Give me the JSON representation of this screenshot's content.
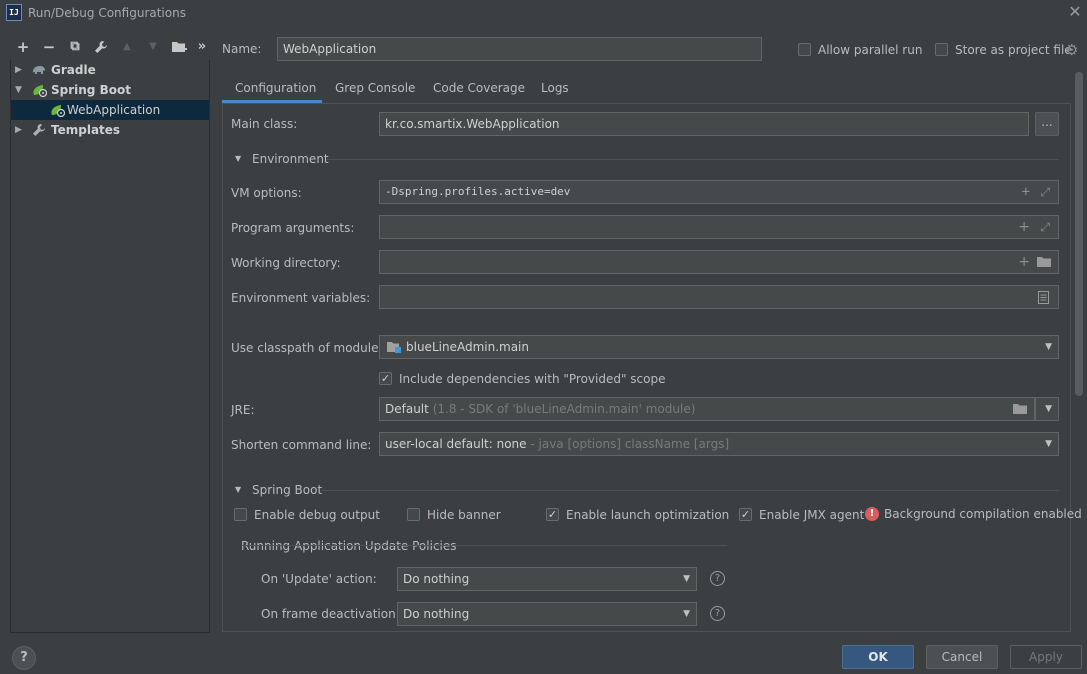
{
  "window": {
    "title": "Run/Debug Configurations"
  },
  "toolbar": {
    "add": "+",
    "remove": "−",
    "copy": "⧉",
    "edit": "🔧",
    "up": "▲",
    "down": "▼",
    "folder": "📁",
    "more": "»"
  },
  "tree": {
    "items": [
      {
        "label": "Gradle",
        "icon": "gradle-elephant-icon"
      },
      {
        "label": "Spring Boot",
        "icon": "spring-boot-icon"
      },
      {
        "label": "WebApplication",
        "icon": "spring-boot-config-icon"
      },
      {
        "label": "Templates",
        "icon": "wrench-icon"
      }
    ]
  },
  "header": {
    "name_label": "Name:",
    "name_value": "WebApplication",
    "allow_parallel_label": "Allow parallel run",
    "allow_parallel_checked": false,
    "store_project_label": "Store as project file",
    "store_project_checked": false
  },
  "tabs": [
    {
      "label": "Configuration",
      "active": true
    },
    {
      "label": "Grep Console",
      "active": false
    },
    {
      "label": "Code Coverage",
      "active": false
    },
    {
      "label": "Logs",
      "active": false
    }
  ],
  "form": {
    "main_class_label": "Main class:",
    "main_class_value": "kr.co.smartix.WebApplication",
    "browse_label": "...",
    "environment_title": "Environment",
    "vm_options_label": "VM options:",
    "vm_options_value": "-Dspring.profiles.active=dev",
    "program_args_label": "Program arguments:",
    "program_args_value": "",
    "working_dir_label": "Working directory:",
    "working_dir_value": "",
    "env_vars_label": "Environment variables:",
    "env_vars_value": "",
    "classpath_label": "Use classpath of module:",
    "classpath_value": "blueLineAdmin.main",
    "include_deps_label": "Include dependencies with \"Provided\" scope",
    "include_deps_checked": true,
    "jre_label": "JRE:",
    "jre_value": "Default",
    "jre_hint": "(1.8 - SDK of 'blueLineAdmin.main' module)",
    "shorten_label": "Shorten command line:",
    "shorten_value": "user-local default: none",
    "shorten_hint": "- java [options] className [args]"
  },
  "spring_boot": {
    "title": "Spring Boot",
    "debug_output_label": "Enable debug output",
    "debug_output_checked": false,
    "hide_banner_label": "Hide banner",
    "hide_banner_checked": false,
    "launch_opt_label": "Enable launch optimization",
    "launch_opt_checked": true,
    "jmx_label": "Enable JMX agent",
    "jmx_checked": true,
    "bg_compilation_label": "Background compilation enabled",
    "policies_title": "Running Application Update Policies",
    "on_update_label": "On 'Update' action:",
    "on_update_value": "Do nothing",
    "on_frame_label": "On frame deactivation:",
    "on_frame_value": "Do nothing"
  },
  "footer": {
    "help": "?",
    "ok": "OK",
    "cancel": "Cancel",
    "apply": "Apply"
  },
  "colors": {
    "accent": "#4a88c7",
    "primary_button": "#365880",
    "selection": "#0d293e",
    "error": "#db5c5c"
  }
}
